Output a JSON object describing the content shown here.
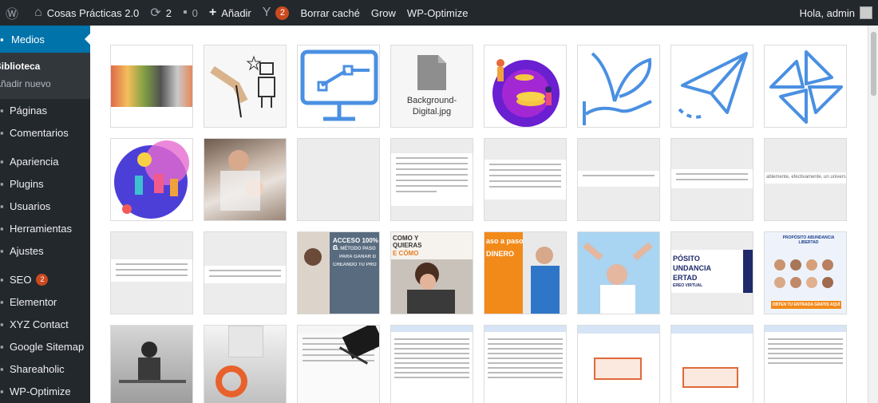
{
  "adminbar": {
    "site_name": "Cosas Prácticas 2.0",
    "updates_count": "2",
    "comments_count": "0",
    "add_new": "Añadir",
    "yoast_count": "2",
    "clear_cache": "Borrar caché",
    "grow": "Grow",
    "wp_optimize": "WP-Optimize",
    "greeting": "Hola, admin"
  },
  "sidebar": {
    "media": "Medios",
    "library": "Biblioteca",
    "add_new": "Añadir nuevo",
    "items": [
      "Páginas",
      "Comentarios",
      "Apariencia",
      "Plugins",
      "Usuarios",
      "Herramientas",
      "Ajustes",
      "SEO",
      "Elementor",
      "XYZ Contact",
      "Google Sitemap",
      "Shareaholic",
      "WP-Optimize"
    ],
    "seo_badge": "2"
  },
  "media_grid": {
    "file_name": "Background-Digital.jpg",
    "banner_texts": {
      "t1": "ACCESO 100% G",
      "t2": "EL MÉTODO PASO",
      "t3": "PARA GANAR D",
      "t4": "CREANDO TU PRO",
      "t5": "COMO Y",
      "t6": "QUIERAS",
      "t7": "E CÓMO",
      "t8": "aso a paso",
      "t9": "DINERO",
      "t10": "PÓSITO",
      "t11": "UNDANCIA",
      "t12": "ERTAD",
      "t13": "EREO VIRTUAL",
      "t14": "PROPÓSITO ABUNDANCIA LIBERTAD",
      "t15": "OBTEN TU ENTRADA GRATIS AQUÍ",
      "t16": "ablemente, efectivamente, un universo y estoy preocu"
    }
  },
  "colors": {
    "adminbar_bg": "#23282d",
    "accent": "#0073aa",
    "badge": "#ca4a1f",
    "icon_blue": "#4a90e2"
  }
}
